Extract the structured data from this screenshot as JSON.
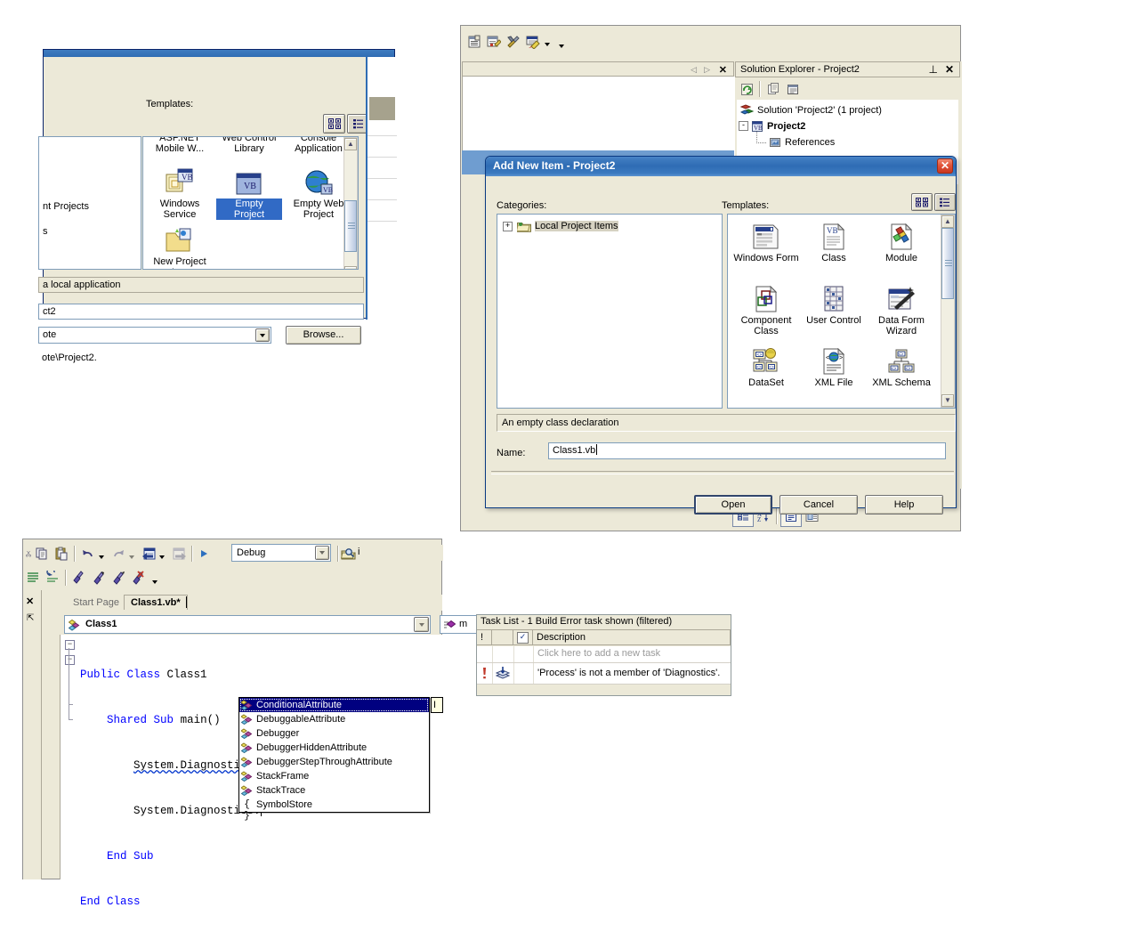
{
  "new_project_dialog": {
    "templates_label": "Templates:",
    "view_large_icon": "large-icons-icon",
    "view_small_icon": "small-icons-icon",
    "left_clipped_texts": [
      "nt Projects",
      "s"
    ],
    "templates_row0": [
      "ASP.NET Mobile W...",
      "Web Control Library",
      "Console Application"
    ],
    "templates": [
      {
        "label": "Windows Service",
        "icon": "windows-service-icon",
        "selected": false
      },
      {
        "label": "Empty Project",
        "icon": "empty-project-icon",
        "selected": true
      },
      {
        "label": "Empty Web Project",
        "icon": "empty-web-project-icon",
        "selected": false
      }
    ],
    "templates_row2": [
      "New Project In..."
    ],
    "description": "a local application",
    "name_value": "ct2",
    "location_value": "ote",
    "browse_label": "Browse...",
    "path_note": "ote\\Project2."
  },
  "ide_window": {
    "toolbar_icons": [
      "properties-window-icon",
      "property-pages-icon",
      "tools-icon",
      "highlighter-icon",
      "chevron-down-icon",
      "toolbar-overflow-icon"
    ],
    "doc_nav": {
      "prev": "prev-icon",
      "next": "next-icon",
      "close": "close-icon"
    },
    "solution_explorer": {
      "title": "Solution Explorer - Project2",
      "pin_icon": "pin-icon",
      "close_icon": "close-icon",
      "toolbar_icons": [
        "refresh-icon",
        "show-all-files-icon",
        "properties-icon"
      ],
      "tree": [
        {
          "label": "Solution 'Project2' (1 project)",
          "icon": "solution-icon",
          "indent": 0,
          "bold": false,
          "expander": ""
        },
        {
          "label": "Project2",
          "icon": "vb-project-icon",
          "indent": 1,
          "bold": true,
          "expander": "-"
        },
        {
          "label": "References",
          "icon": "references-icon",
          "indent": 2,
          "bold": false,
          "expander": ""
        }
      ]
    },
    "bottom_toolbar_icons": [
      "categorized-icon",
      "alphabetical-icon",
      "property-pages-icon",
      "property-window-icon"
    ]
  },
  "add_new_item_dialog": {
    "title": "Add New Item - Project2",
    "close_icon": "close-icon",
    "categories_label": "Categories:",
    "templates_label": "Templates:",
    "view_large_icon": "large-icons-icon",
    "view_small_icon": "small-icons-icon",
    "category_tree": [
      {
        "label": "Local Project Items",
        "icon": "folder-icon",
        "expander": "+"
      }
    ],
    "templates": [
      {
        "label": "Windows Form",
        "icon": "windows-form-icon"
      },
      {
        "label": "Class",
        "icon": "class-icon"
      },
      {
        "label": "Module",
        "icon": "module-icon"
      },
      {
        "label": "Component Class",
        "icon": "component-class-icon"
      },
      {
        "label": "User Control",
        "icon": "user-control-icon"
      },
      {
        "label": "Data Form Wizard",
        "icon": "data-form-wizard-icon"
      },
      {
        "label": "DataSet",
        "icon": "dataset-icon"
      },
      {
        "label": "XML File",
        "icon": "xml-file-icon"
      },
      {
        "label": "XML Schema",
        "icon": "xml-schema-icon"
      }
    ],
    "description": "An empty class declaration",
    "name_label": "Name:",
    "name_value": "Class1.vb",
    "buttons": {
      "open": "Open",
      "cancel": "Cancel",
      "help": "Help"
    }
  },
  "editor_window": {
    "toolbar1_icons": [
      "cut-icon",
      "copy-icon",
      "paste-icon",
      "undo-icon",
      "chevron-down-icon",
      "redo-icon",
      "chevron-down-icon",
      "navigate-back-icon",
      "chevron-down-icon",
      "navigate-forward-icon",
      "start-icon"
    ],
    "config_value": "Debug",
    "find_icon": "find-in-files-icon",
    "find_value": "i",
    "toolbar2_icons": [
      "comment-icon",
      "uncomment-icon",
      "bookmark-icon",
      "next-bookmark-icon",
      "prev-bookmark-icon",
      "clear-bookmarks-icon",
      "chevron-down-icon"
    ],
    "tabs": [
      {
        "label": "Start Page",
        "active": false
      },
      {
        "label": "Class1.vb*",
        "active": true
      }
    ],
    "class_dropdown": {
      "value": "Class1",
      "icon": "class-icon"
    },
    "member_dropdown": {
      "value": "m",
      "icon": "method-icon"
    },
    "code_lines": [
      {
        "indent": 0,
        "tokens": [
          {
            "t": "Public",
            "k": true
          },
          {
            "t": " ",
            "k": false
          },
          {
            "t": "Class",
            "k": true
          },
          {
            "t": " Class1",
            "k": false
          }
        ],
        "fold": "-"
      },
      {
        "indent": 1,
        "tokens": [
          {
            "t": "Shared",
            "k": true
          },
          {
            "t": " ",
            "k": false
          },
          {
            "t": "Sub",
            "k": true
          },
          {
            "t": " main()",
            "k": false
          }
        ],
        "fold": "-"
      },
      {
        "indent": 2,
        "tokens": [
          {
            "t": "System.Diagnostics.Process",
            "k": false,
            "err": true
          },
          {
            "t": "()",
            "k": false
          }
        ],
        "fold": ""
      },
      {
        "indent": 2,
        "tokens": [
          {
            "t": "System.Diagnostics.",
            "k": false
          }
        ],
        "fold": "",
        "caret": true
      },
      {
        "indent": 1,
        "tokens": [
          {
            "t": "End",
            "k": true
          },
          {
            "t": " ",
            "k": false
          },
          {
            "t": "Sub",
            "k": true
          }
        ],
        "fold": ""
      },
      {
        "indent": 0,
        "tokens": [
          {
            "t": "End",
            "k": true
          },
          {
            "t": " ",
            "k": false
          },
          {
            "t": "Class",
            "k": true
          }
        ],
        "fold": ""
      }
    ],
    "intellisense": {
      "items": [
        {
          "label": "ConditionalAttribute",
          "icon": "class-member-icon",
          "selected": true
        },
        {
          "label": "DebuggableAttribute",
          "icon": "class-member-icon",
          "selected": false
        },
        {
          "label": "Debugger",
          "icon": "class-member-icon",
          "selected": false
        },
        {
          "label": "DebuggerHiddenAttribute",
          "icon": "class-member-icon",
          "selected": false
        },
        {
          "label": "DebuggerStepThroughAttribute",
          "icon": "class-member-icon",
          "selected": false
        },
        {
          "label": "StackFrame",
          "icon": "class-member-icon",
          "selected": false
        },
        {
          "label": "StackTrace",
          "icon": "class-member-icon",
          "selected": false
        },
        {
          "label": "SymbolStore",
          "icon": "namespace-icon",
          "selected": false
        }
      ]
    },
    "tooltip_text": "I"
  },
  "task_list": {
    "title": "Task List - 1 Build Error task shown (filtered)",
    "columns": [
      "!",
      "",
      "✓",
      "Description"
    ],
    "new_task_placeholder": "Click here to add a new task",
    "rows": [
      {
        "priority_icon": "error-icon",
        "type_icon": "build-error-icon",
        "description": "'Process' is not a member of 'Diagnostics'."
      }
    ]
  },
  "colors": {
    "titlebar_blue": "#2f6cb4",
    "dialog_face": "#ece9d8",
    "selection_blue": "#316ac5",
    "intellisense_sel": "#000080",
    "keyword_blue": "#0000ff",
    "panel_blue": "#6f9dd0"
  }
}
